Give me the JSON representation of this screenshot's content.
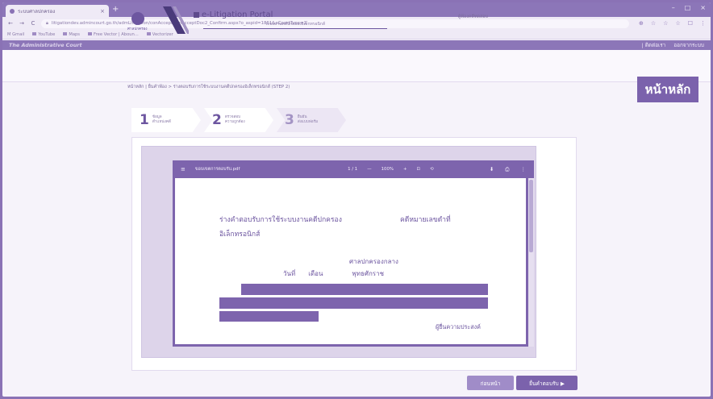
{
  "browser": {
    "tab_title": "ระบบศาลปกครอง",
    "tab_close": "×",
    "new_tab": "+",
    "window_controls": [
      "–",
      "□",
      "×"
    ],
    "url": "litigationdev.admincourt.go.th/admLitigation/conAccept/frmAcceptDoc2_Confirm.aspx?o_aspid=1861&oCourtType=1",
    "nav": {
      "back": "←",
      "forward": "→",
      "reload": "C"
    },
    "addr_icons": [
      "⊕",
      "☆",
      "☆",
      "☆",
      "☐",
      "⋮"
    ],
    "bookmarks": [
      "M Gmail",
      "YouTube",
      "Maps",
      "Free Vector | Aboun...",
      "Vectorizer"
    ]
  },
  "site": {
    "brand": "The Administrative Court",
    "right_links": [
      "| ติดต่อเรา",
      "ออกจากระบบ"
    ]
  },
  "portal": {
    "emblem_caption": "ศาลปกครอง",
    "title": "e-Litigation Portal",
    "subtitle": "ระบบงานคดีปกครองอิเล็กทรอนิกส์",
    "user": "ผู้ฟ้องคดีทดสอบ",
    "breadcrumb": "หน้าหลัก  |  ยื่นคำฟ้อง  >  ร่างตอบรับการใช้ระบบงานคดีปกครองอิเล็กทรอนิกส์ (STEP 2)",
    "home_button": "หน้าหลัก"
  },
  "steps": [
    {
      "num": "1",
      "label1": "ข้อมูล",
      "label2": "ตำแหน่งคดี"
    },
    {
      "num": "2",
      "label1": "ตรวจสอบ",
      "label2": "ความถูกต้อง"
    },
    {
      "num": "3",
      "label1": "ยืนยัน",
      "label2": "ส่งแบบฟอร์ม"
    }
  ],
  "pdf": {
    "menu_icon": "≡",
    "filename": "ขอบเขตการตอบรับ.pdf",
    "page": "1 / 1",
    "zoom_out": "—",
    "zoom": "100%",
    "zoom_in": "+",
    "fit_icon": "⊡",
    "rotate_icon": "⟲",
    "download_icon": "⬇",
    "print_icon": "⎙",
    "more_icon": "⋮"
  },
  "document": {
    "title_line1": "ร่างคำตอบรับการใช้ระบบงานคดีปกครอง",
    "case_number": "คดีหมายเลขดำที่",
    "title_line2": "อิเล็กทรอนิกส์",
    "court": "ศาลปกครองกลาง",
    "date_day": "วันที่",
    "date_month": "เดือน",
    "date_year": "พุทธศักราช",
    "signature": "ผู้ยื่นความประสงค์"
  },
  "buttons": {
    "back": "ก่อนหน้า",
    "next": "ยื่นคำตอบรับ ▶"
  },
  "colors": {
    "accent": "#7b62ac",
    "frame": "#8a72b5"
  }
}
